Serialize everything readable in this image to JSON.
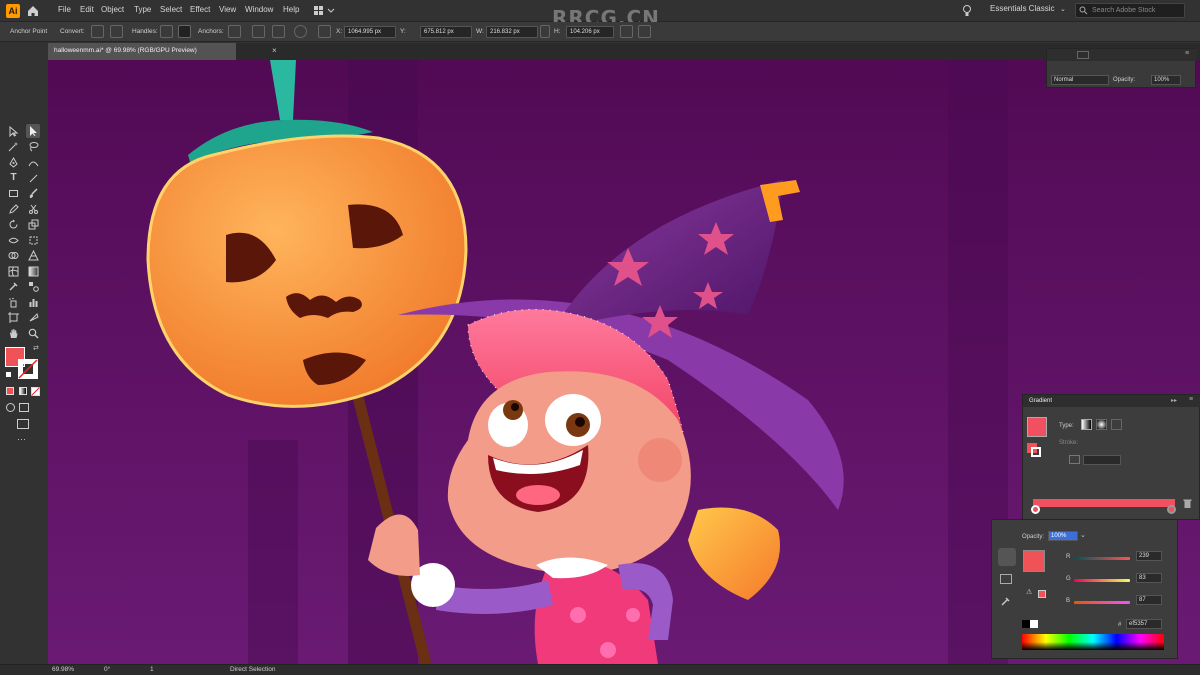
{
  "app": {
    "name": "Adobe Illustrator",
    "watermark": "RRCG.CN",
    "workspace": "Essentials Classic",
    "search_placeholder": "Search Adobe Stock"
  },
  "menu": [
    "File",
    "Edit",
    "Object",
    "Type",
    "Select",
    "Effect",
    "View",
    "Window",
    "Help"
  ],
  "control_bar": {
    "tool_name": "Anchor Point",
    "convert_label": "Convert:",
    "handles_label": "Handles:",
    "anchors_label": "Anchors:",
    "x": "1064.995 px",
    "y": "675.812 px",
    "w": "216.832 px",
    "h": "104.206 px"
  },
  "document_tab": {
    "title": "halloweenmm.ai* @ 69.98% (RGB/GPU Preview)",
    "close": "×"
  },
  "transparency_panel": {
    "blend_mode": "Normal",
    "opacity_label": "Opacity:",
    "opacity_value": "100%"
  },
  "gradient_panel": {
    "title": "Gradient",
    "type_label": "Type:",
    "stroke_label": "Stroke:",
    "colors": {
      "stop_color": "#f0505f",
      "bar_color": "#f0505f"
    }
  },
  "color_panel": {
    "opacity_label": "Opacity:",
    "opacity_value": "100%",
    "r_label": "R",
    "r_value": "239",
    "g_label": "G",
    "g_value": "83",
    "b_label": "B",
    "b_value": "87",
    "hex_label": "#",
    "hex_value": "ef5357",
    "swatch_color": "#ef5357"
  },
  "status_bar": {
    "zoom": "69.98%",
    "rotation": "0°",
    "artboard": "1",
    "tool": "Direct Selection"
  },
  "colors": {
    "fill": "#ef5357",
    "canvas_bg": "#5b1160",
    "accent": "#ff9a00"
  },
  "icons": [
    "adobe-ai-logo-icon",
    "home-icon",
    "lightbulb-icon",
    "search-icon",
    "selection-tool-icon",
    "direct-selection-tool-icon",
    "pen-tool-icon",
    "type-tool-icon",
    "zoom-tool-icon",
    "hand-tool-icon",
    "close-icon",
    "delete-icon",
    "eyedropper-icon"
  ]
}
